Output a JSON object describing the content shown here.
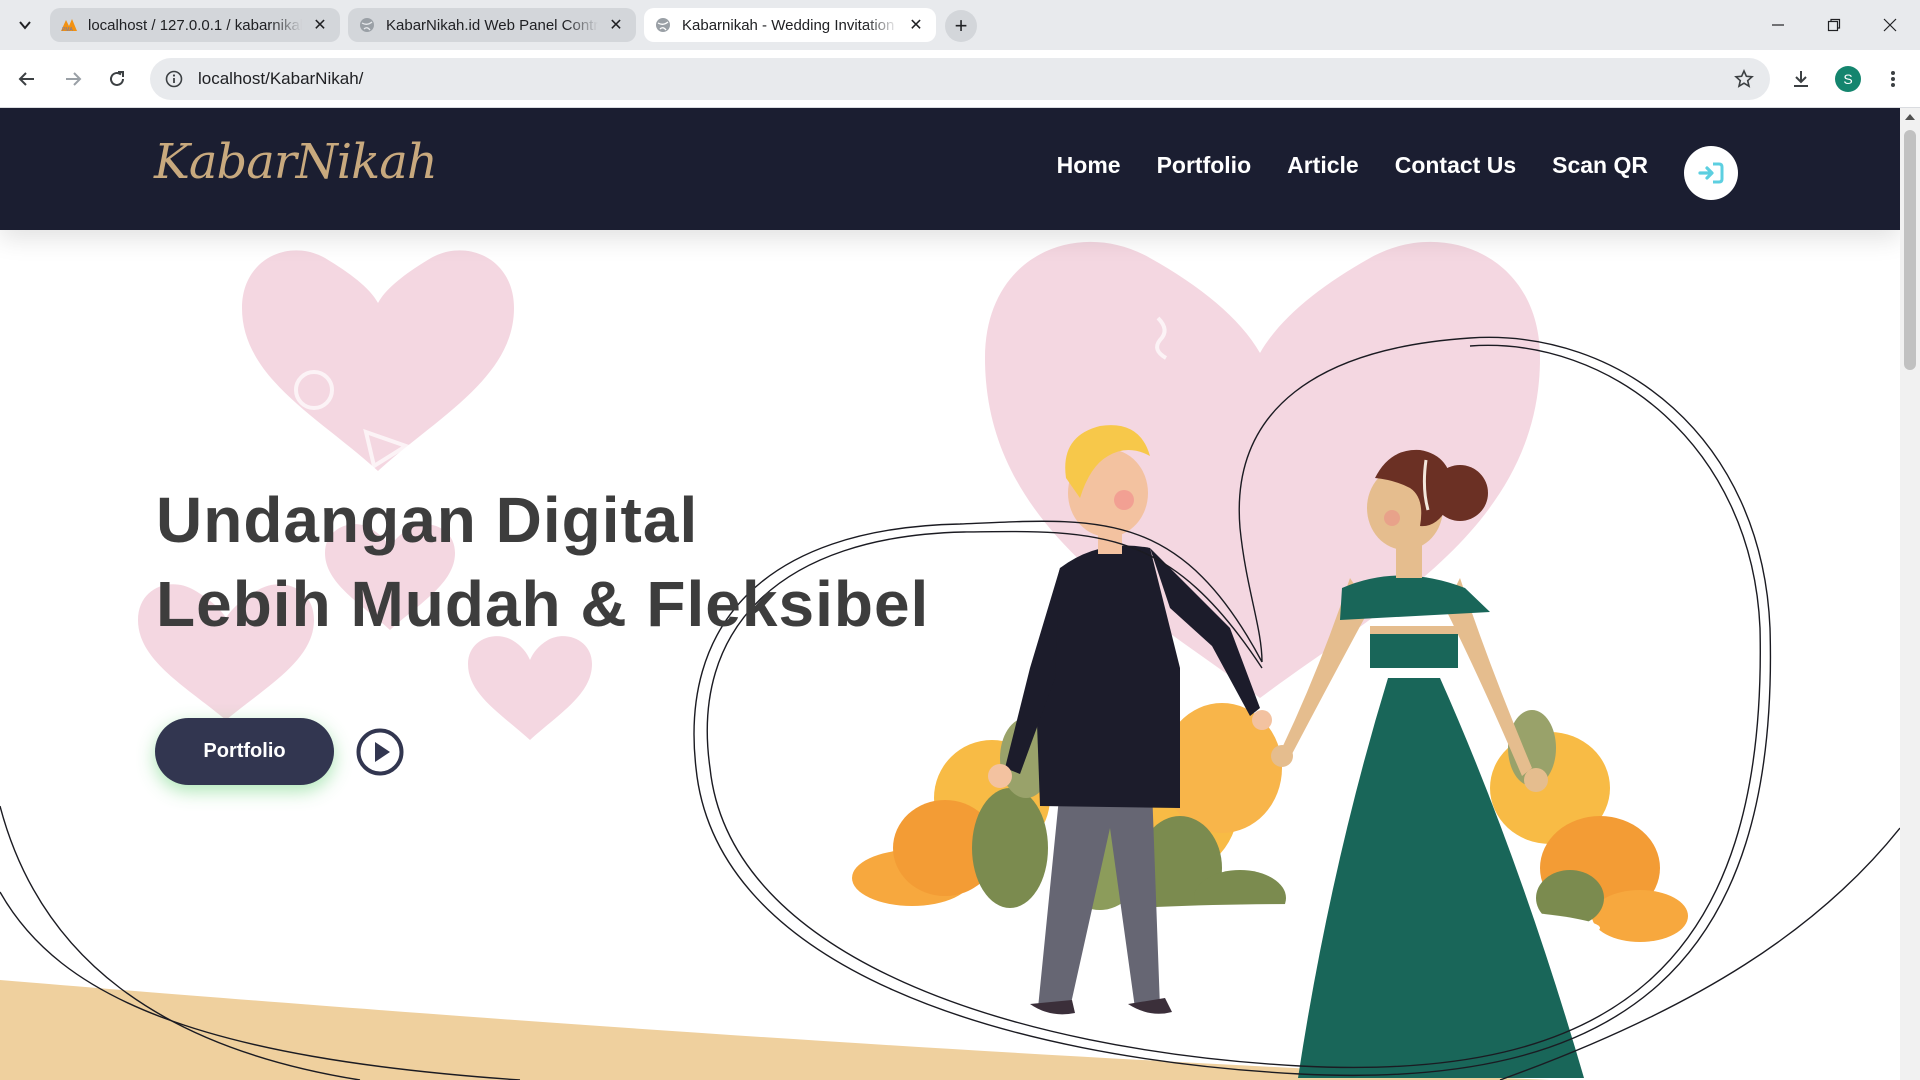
{
  "browser": {
    "tabs": [
      {
        "title": "localhost / 127.0.0.1 / kabarnikah",
        "icon": "phpmyadmin-icon",
        "active": false
      },
      {
        "title": "KabarNikah.id Web Panel Control",
        "icon": "globe-icon",
        "active": false
      },
      {
        "title": "Kabarnikah - Wedding Invitation",
        "icon": "globe-icon",
        "active": true
      }
    ],
    "url": "localhost/KabarNikah/",
    "profile_initial": "S"
  },
  "site": {
    "logo": "KabarNikah",
    "nav": [
      "Home",
      "Portfolio",
      "Article",
      "Contact Us",
      "Scan QR"
    ],
    "hero": {
      "title_line1": "Undangan Digital",
      "title_line2": "Lebih Mudah & Fleksibel",
      "cta_label": "Portfolio"
    },
    "colors": {
      "header_bg": "#1b1e31",
      "logo": "#c8a97e",
      "cta_bg": "#323650",
      "heart_pink": "#f4d7e1",
      "footer_wave": "#efd09e",
      "login_icon": "#5ccfe0"
    }
  }
}
